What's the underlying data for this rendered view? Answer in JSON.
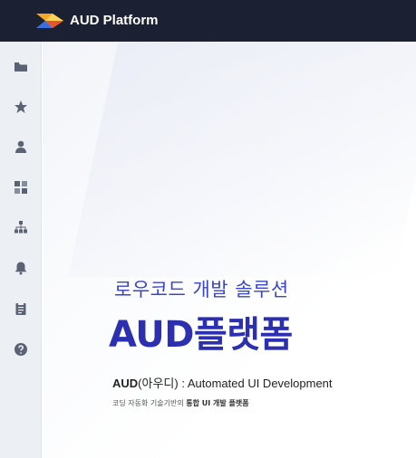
{
  "header": {
    "app_title": "AUD Platform",
    "logo_icon": "aud-arrow-logo",
    "bg_color": "#1b2133"
  },
  "sidebar": {
    "items": [
      {
        "icon": "folder-icon",
        "label": ""
      },
      {
        "icon": "star-icon",
        "label": ""
      },
      {
        "icon": "user-icon",
        "label": ""
      },
      {
        "icon": "dashboard-icon",
        "label": ""
      },
      {
        "icon": "sitemap-icon",
        "label": ""
      },
      {
        "icon": "bell-icon",
        "label": ""
      },
      {
        "icon": "clipboard-icon",
        "label": ""
      },
      {
        "icon": "help-icon",
        "label": ""
      }
    ]
  },
  "hero": {
    "tagline": "로우코드 개발 솔루션",
    "brand": "AUD플랫폼",
    "desc_bold": "AUD",
    "desc_rest": "(아우디) : Automated UI Development",
    "subdesc_pre": "코딩 자동화 기술기반의 ",
    "subdesc_bold": "통합 UI 개발 플랫폼",
    "accent_color": "#2b2fb0"
  }
}
